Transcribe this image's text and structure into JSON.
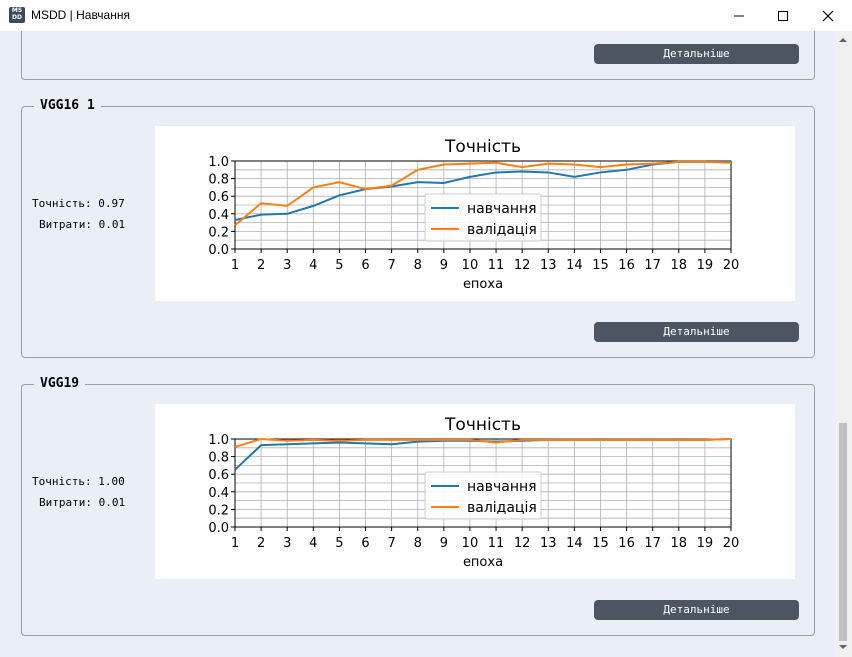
{
  "window": {
    "title": "MSDD | Навчання",
    "icon_label": "MS DD",
    "icons": {
      "app": "app-logo-icon",
      "minimize": "minimize-icon",
      "maximize": "maximize-icon",
      "close": "close-icon"
    }
  },
  "details_label": "Детальніше",
  "models": [
    {
      "name": "",
      "accuracy_label": "",
      "loss_label": "",
      "details_label": "Детальніше"
    },
    {
      "name": "VGG16 1",
      "accuracy_label": "Точність: 0.97",
      "loss_label": "Витрати: 0.01",
      "details_label": "Детальніше"
    },
    {
      "name": "VGG19",
      "accuracy_label": "Точність: 1.00",
      "loss_label": "Витрати: 0.01",
      "details_label": "Детальніше"
    }
  ],
  "chart_data": [
    {
      "type": "line",
      "title": "Точність",
      "xlabel": "епоха",
      "ylabel": "",
      "x": [
        1,
        2,
        3,
        4,
        5,
        6,
        7,
        8,
        9,
        10,
        11,
        12,
        13,
        14,
        15,
        16,
        17,
        18,
        19,
        20
      ],
      "xlim": [
        1,
        20
      ],
      "ylim": [
        0.0,
        1.0
      ],
      "yticks": [
        "0.0",
        "0.2",
        "0.4",
        "0.6",
        "0.8",
        "1.0"
      ],
      "xticks": [
        "1",
        "2",
        "3",
        "4",
        "5",
        "6",
        "7",
        "8",
        "9",
        "10",
        "11",
        "12",
        "13",
        "14",
        "15",
        "16",
        "17",
        "18",
        "19",
        "20"
      ],
      "grid": true,
      "legend": "center",
      "series": [
        {
          "name": "навчання",
          "color": "#1f77b4",
          "values": [
            0.33,
            0.39,
            0.4,
            0.49,
            0.61,
            0.68,
            0.71,
            0.76,
            0.75,
            0.82,
            0.87,
            0.88,
            0.87,
            0.82,
            0.87,
            0.9,
            0.96,
            0.99,
            0.99,
            0.99
          ]
        },
        {
          "name": "валідація",
          "color": "#ff7f0e",
          "values": [
            0.27,
            0.52,
            0.49,
            0.7,
            0.76,
            0.68,
            0.72,
            0.9,
            0.96,
            0.97,
            0.98,
            0.93,
            0.97,
            0.96,
            0.93,
            0.96,
            0.97,
            0.99,
            0.99,
            0.98
          ]
        }
      ]
    },
    {
      "type": "line",
      "title": "Точність",
      "xlabel": "епоха",
      "ylabel": "",
      "x": [
        1,
        2,
        3,
        4,
        5,
        6,
        7,
        8,
        9,
        10,
        11,
        12,
        13,
        14,
        15,
        16,
        17,
        18,
        19,
        20
      ],
      "xlim": [
        1,
        20
      ],
      "ylim": [
        0.0,
        1.0
      ],
      "yticks": [
        "0.0",
        "0.2",
        "0.4",
        "0.6",
        "0.8",
        "1.0"
      ],
      "xticks": [
        "1",
        "2",
        "3",
        "4",
        "5",
        "6",
        "7",
        "8",
        "9",
        "10",
        "11",
        "12",
        "13",
        "14",
        "15",
        "16",
        "17",
        "18",
        "19",
        "20"
      ],
      "grid": true,
      "legend": "center",
      "series": [
        {
          "name": "навчання",
          "color": "#1f77b4",
          "values": [
            0.65,
            0.93,
            0.94,
            0.95,
            0.96,
            0.95,
            0.94,
            0.97,
            0.98,
            0.98,
            0.97,
            0.98,
            0.99,
            0.99,
            0.99,
            0.99,
            0.99,
            0.99,
            0.99,
            1.0
          ]
        },
        {
          "name": "валідація",
          "color": "#ff7f0e",
          "values": [
            0.91,
            1.0,
            0.98,
            0.99,
            0.98,
            0.99,
            0.99,
            0.99,
            0.99,
            0.99,
            0.96,
            0.99,
            0.99,
            0.99,
            0.99,
            0.99,
            0.99,
            0.99,
            0.99,
            1.0
          ]
        }
      ]
    }
  ]
}
